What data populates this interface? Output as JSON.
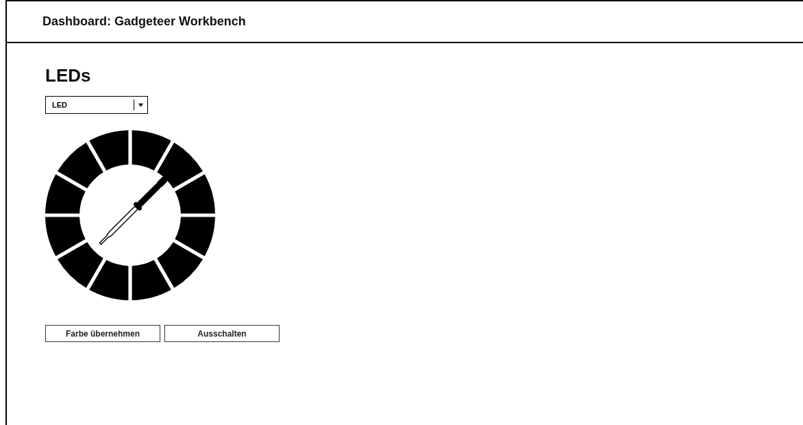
{
  "header": {
    "title": "Dashboard: Gadgeteer Workbench"
  },
  "section": {
    "title": "LEDs"
  },
  "led_select": {
    "value": "LED"
  },
  "buttons": [
    {
      "label": "Farbe übernehmen"
    },
    {
      "label": "Ausschalten"
    }
  ]
}
